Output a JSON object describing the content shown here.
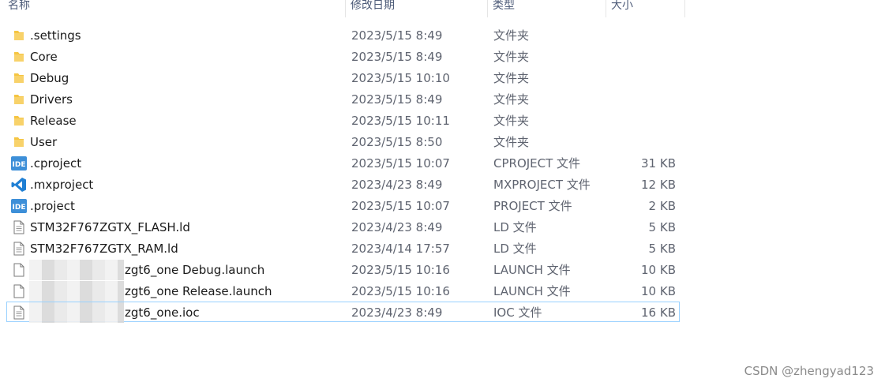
{
  "columns": {
    "name": "名称",
    "date": "修改日期",
    "type": "类型",
    "size": "大小"
  },
  "rows": [
    {
      "name": ".settings",
      "date": "2023/5/15 8:49",
      "type": "文件夹",
      "size": "",
      "icon": "folder-icon"
    },
    {
      "name": "Core",
      "date": "2023/5/15 8:49",
      "type": "文件夹",
      "size": "",
      "icon": "folder-icon"
    },
    {
      "name": "Debug",
      "date": "2023/5/15 10:10",
      "type": "文件夹",
      "size": "",
      "icon": "folder-icon"
    },
    {
      "name": "Drivers",
      "date": "2023/5/15 8:49",
      "type": "文件夹",
      "size": "",
      "icon": "folder-icon"
    },
    {
      "name": "Release",
      "date": "2023/5/15 10:11",
      "type": "文件夹",
      "size": "",
      "icon": "folder-icon"
    },
    {
      "name": "User",
      "date": "2023/5/15 8:50",
      "type": "文件夹",
      "size": "",
      "icon": "folder-icon"
    },
    {
      "name": ".cproject",
      "date": "2023/5/15 10:07",
      "type": "CPROJECT 文件",
      "size": "31 KB",
      "icon": "ide-icon"
    },
    {
      "name": ".mxproject",
      "date": "2023/4/23 8:49",
      "type": "MXPROJECT 文件",
      "size": "12 KB",
      "icon": "vscode-icon"
    },
    {
      "name": ".project",
      "date": "2023/5/15 10:07",
      "type": "PROJECT 文件",
      "size": "2 KB",
      "icon": "ide-icon"
    },
    {
      "name": "STM32F767ZGTX_FLASH.ld",
      "date": "2023/4/23 8:49",
      "type": "LD 文件",
      "size": "5 KB",
      "icon": "text-file-icon"
    },
    {
      "name": "STM32F767ZGTX_RAM.ld",
      "date": "2023/4/14 17:57",
      "type": "LD 文件",
      "size": "5 KB",
      "icon": "text-file-icon"
    },
    {
      "name": "zgt6_one Debug.launch",
      "date": "2023/5/15 10:16",
      "type": "LAUNCH 文件",
      "size": "10 KB",
      "icon": "blank-file-icon"
    },
    {
      "name": "zgt6_one Release.launch",
      "date": "2023/5/15 10:16",
      "type": "LAUNCH 文件",
      "size": "10 KB",
      "icon": "blank-file-icon"
    },
    {
      "name": "zgt6_one.ioc",
      "date": "2023/4/23 8:49",
      "type": "IOC 文件",
      "size": "16 KB",
      "icon": "text-file-icon"
    }
  ],
  "watermark": "CSDN @zhengyad123",
  "colors": {
    "folder": "#f5c542",
    "ide": "#3d8fd8",
    "vscode": "#1f7fd4",
    "selection": "#99d1ff"
  }
}
